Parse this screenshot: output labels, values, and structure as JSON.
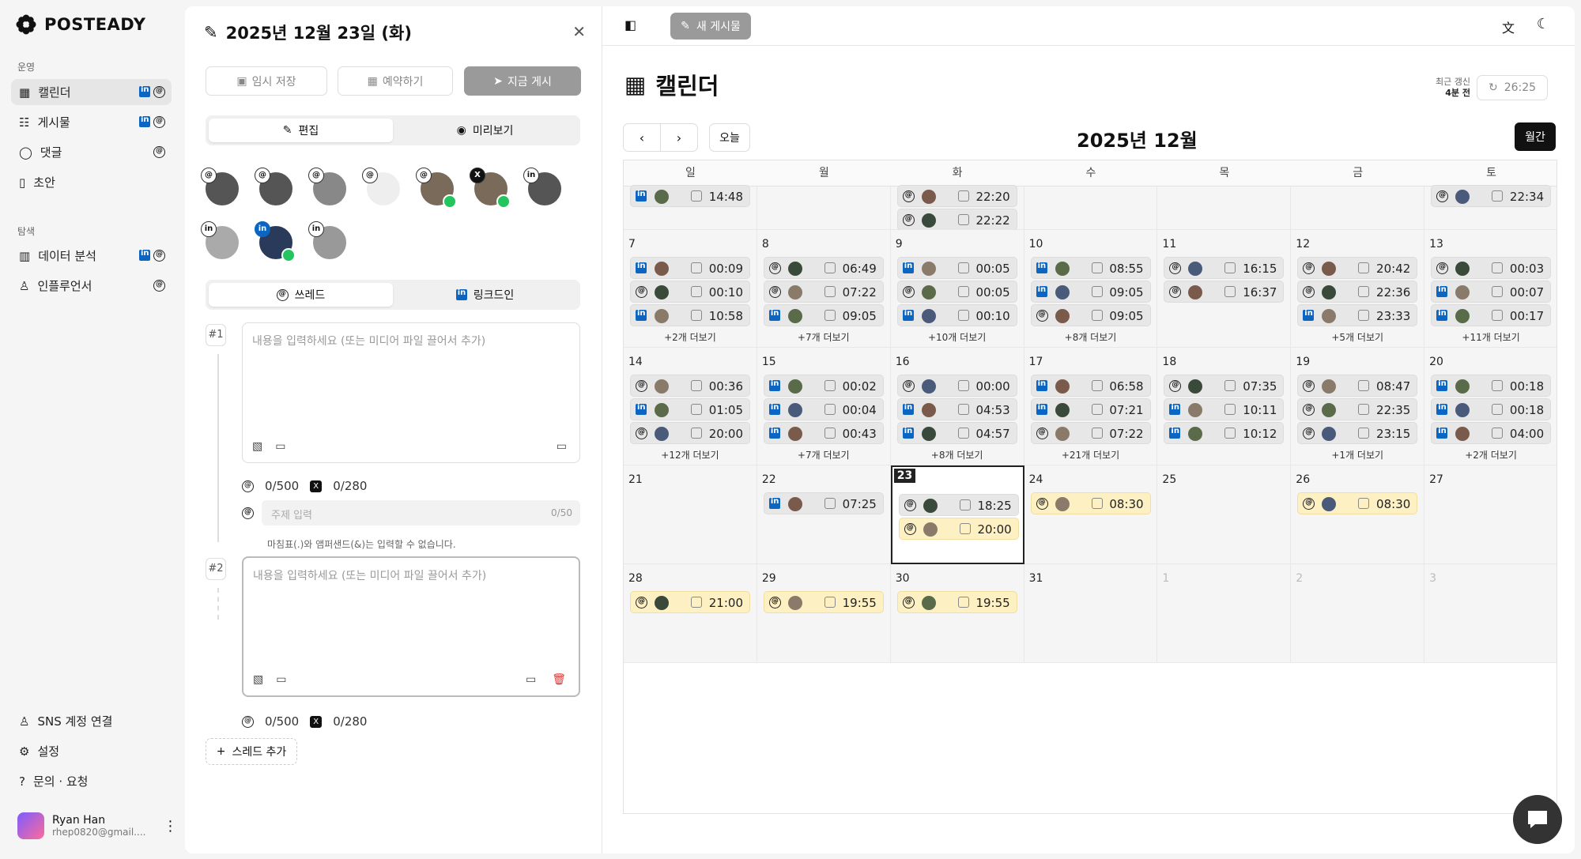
{
  "sidebar": {
    "brand": "POSTEADY",
    "section_ops": "운영",
    "section_explore": "탐색",
    "items": [
      {
        "label": "캘린더"
      },
      {
        "label": "게시물"
      },
      {
        "label": "댓글"
      },
      {
        "label": "초안"
      }
    ],
    "explore": [
      {
        "label": "데이터 분석"
      },
      {
        "label": "인플루언서"
      }
    ],
    "bottom": [
      {
        "label": "SNS 계정 연결"
      },
      {
        "label": "설정"
      },
      {
        "label": "문의 · 요청"
      }
    ],
    "user": {
      "name": "Ryan Han",
      "email": "rhep0820@gmail...."
    }
  },
  "editor": {
    "title": "2025년 12월 23일 (화)",
    "save_label": "임시 저장",
    "schedule_label": "예약하기",
    "post_now_label": "지금 게시",
    "tab_edit": "편집",
    "tab_preview": "미리보기",
    "net_threads": "쓰레드",
    "net_linkedin": "링크드인",
    "thread1": {
      "num": "#1",
      "placeholder": "내용을 입력하세요 (또는 미디어 파일 끌어서 추가)",
      "count_threads": "0/500",
      "count_x": "0/280"
    },
    "topic": {
      "placeholder": "주제 입력",
      "count": "0/50",
      "hint": "마침표(.)와 앰퍼샌드(&)는 입력할 수 없습니다."
    },
    "thread2": {
      "num": "#2",
      "placeholder": "내용을 입력하세요 (또는 미디어 파일 끌어서 추가)",
      "count_threads": "0/500",
      "count_x": "0/280"
    },
    "add_thread": "스레드 추가"
  },
  "main": {
    "new_post": "새 게시물",
    "title": "캘린더",
    "refresh_label1": "최근 갱신",
    "refresh_label2": "4분 전",
    "refresh_time": "26:25",
    "today_btn": "오늘",
    "month": "2025년 12월",
    "view": "월간",
    "weekdays": [
      "일",
      "월",
      "화",
      "수",
      "목",
      "금",
      "토"
    ]
  },
  "colors": {
    "linkedin": "#0a66c2",
    "yellow_post": "#fdf0c2",
    "accent_dark": "#111111"
  },
  "calendar": {
    "rows": [
      {
        "cells": [
          {
            "day": "",
            "posts": [
              [
                "li",
                "14:48"
              ]
            ],
            "more": ""
          },
          {
            "day": "",
            "posts": [],
            "more": ""
          },
          {
            "day": "",
            "posts": [
              [
                "th",
                "22:20"
              ],
              [
                "th",
                "22:22"
              ]
            ],
            "more": ""
          },
          {
            "day": "",
            "posts": [],
            "more": ""
          },
          {
            "day": "",
            "posts": [],
            "more": ""
          },
          {
            "day": "",
            "posts": [],
            "more": ""
          },
          {
            "day": "",
            "posts": [
              [
                "th",
                "22:34"
              ]
            ],
            "more": ""
          }
        ]
      },
      {
        "cells": [
          {
            "day": "7",
            "posts": [
              [
                "li",
                "00:09"
              ],
              [
                "th",
                "00:10"
              ],
              [
                "li",
                "10:58"
              ]
            ],
            "more": "+2개 더보기"
          },
          {
            "day": "8",
            "posts": [
              [
                "th",
                "06:49"
              ],
              [
                "th",
                "07:22"
              ],
              [
                "li",
                "09:05"
              ]
            ],
            "more": "+7개 더보기"
          },
          {
            "day": "9",
            "posts": [
              [
                "li",
                "00:05"
              ],
              [
                "th",
                "00:05"
              ],
              [
                "li",
                "00:10"
              ]
            ],
            "more": "+10개 더보기"
          },
          {
            "day": "10",
            "posts": [
              [
                "li",
                "08:55"
              ],
              [
                "li",
                "09:05"
              ],
              [
                "th",
                "09:05"
              ]
            ],
            "more": "+8개 더보기"
          },
          {
            "day": "11",
            "posts": [
              [
                "th",
                "16:15"
              ],
              [
                "th",
                "16:37"
              ]
            ],
            "more": ""
          },
          {
            "day": "12",
            "posts": [
              [
                "th",
                "20:42"
              ],
              [
                "th",
                "22:36"
              ],
              [
                "li",
                "23:33"
              ]
            ],
            "more": "+5개 더보기"
          },
          {
            "day": "13",
            "posts": [
              [
                "th",
                "00:03"
              ],
              [
                "li",
                "00:07"
              ],
              [
                "li",
                "00:17"
              ]
            ],
            "more": "+11개 더보기"
          }
        ]
      },
      {
        "cells": [
          {
            "day": "14",
            "posts": [
              [
                "th",
                "00:36"
              ],
              [
                "li",
                "01:05"
              ],
              [
                "th",
                "20:00"
              ]
            ],
            "more": "+12개 더보기"
          },
          {
            "day": "15",
            "posts": [
              [
                "li",
                "00:02"
              ],
              [
                "li",
                "00:04"
              ],
              [
                "li",
                "00:43"
              ]
            ],
            "more": "+7개 더보기"
          },
          {
            "day": "16",
            "posts": [
              [
                "th",
                "00:00"
              ],
              [
                "li",
                "04:53"
              ],
              [
                "li",
                "04:57"
              ]
            ],
            "more": "+8개 더보기"
          },
          {
            "day": "17",
            "posts": [
              [
                "li",
                "06:58"
              ],
              [
                "li",
                "07:21"
              ],
              [
                "th",
                "07:22"
              ]
            ],
            "more": "+21개 더보기"
          },
          {
            "day": "18",
            "posts": [
              [
                "th",
                "07:35"
              ],
              [
                "li",
                "10:11"
              ],
              [
                "li",
                "10:12"
              ]
            ],
            "more": ""
          },
          {
            "day": "19",
            "posts": [
              [
                "th",
                "08:47"
              ],
              [
                "th",
                "22:35"
              ],
              [
                "th",
                "23:15"
              ]
            ],
            "more": "+1개 더보기"
          },
          {
            "day": "20",
            "posts": [
              [
                "li",
                "00:18"
              ],
              [
                "li",
                "00:18"
              ],
              [
                "li",
                "04:00"
              ]
            ],
            "more": "+2개 더보기"
          }
        ]
      },
      {
        "cells": [
          {
            "day": "21",
            "posts": [],
            "more": ""
          },
          {
            "day": "22",
            "posts": [
              [
                "li",
                "07:25"
              ]
            ],
            "more": ""
          },
          {
            "day": "23",
            "posts": [
              [
                "th",
                "18:25"
              ],
              [
                "thy",
                "20:00"
              ]
            ],
            "more": "",
            "today": true
          },
          {
            "day": "24",
            "posts": [
              [
                "thy",
                "08:30"
              ]
            ],
            "more": ""
          },
          {
            "day": "25",
            "posts": [],
            "more": ""
          },
          {
            "day": "26",
            "posts": [
              [
                "thy",
                "08:30"
              ]
            ],
            "more": ""
          },
          {
            "day": "27",
            "posts": [],
            "more": ""
          }
        ]
      },
      {
        "cells": [
          {
            "day": "28",
            "posts": [
              [
                "thy",
                "21:00"
              ]
            ],
            "more": ""
          },
          {
            "day": "29",
            "posts": [
              [
                "thy",
                "19:55"
              ]
            ],
            "more": ""
          },
          {
            "day": "30",
            "posts": [
              [
                "thy",
                "19:55"
              ]
            ],
            "more": ""
          },
          {
            "day": "31",
            "posts": [],
            "more": ""
          },
          {
            "day": "1",
            "posts": [],
            "more": "",
            "other": true
          },
          {
            "day": "2",
            "posts": [],
            "more": "",
            "other": true
          },
          {
            "day": "3",
            "posts": [],
            "more": "",
            "other": true
          }
        ]
      }
    ]
  }
}
